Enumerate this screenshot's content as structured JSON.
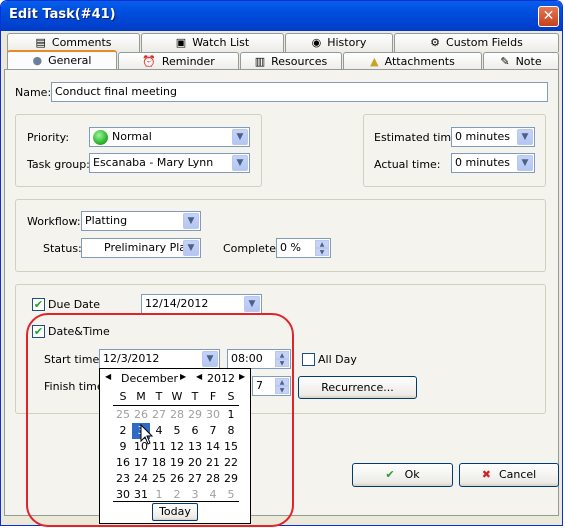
{
  "window": {
    "title": "Edit Task(#41)",
    "close_glyph": "✕"
  },
  "tabs_top": [
    {
      "label": "Comments",
      "icon": "comments-icon"
    },
    {
      "label": "Watch List",
      "icon": "watch-list-icon"
    },
    {
      "label": "History",
      "icon": "history-icon"
    },
    {
      "label": "Custom Fields",
      "icon": "custom-fields-icon"
    }
  ],
  "tabs_bottom": [
    {
      "label": "General",
      "icon": "general-icon",
      "active": true
    },
    {
      "label": "Reminder",
      "icon": "reminder-icon"
    },
    {
      "label": "Resources",
      "icon": "resources-icon"
    },
    {
      "label": "Attachments",
      "icon": "attachments-icon"
    },
    {
      "label": "Note",
      "icon": "note-icon"
    }
  ],
  "name": {
    "label": "Name:",
    "value": "Conduct final meeting"
  },
  "priority": {
    "label": "Priority:",
    "value": "Normal",
    "color": "#2fb52f"
  },
  "task_group": {
    "label": "Task group:",
    "value": "Escanaba - Mary Lynn"
  },
  "estimated_time": {
    "label": "Estimated time:",
    "value": "0 minutes"
  },
  "actual_time": {
    "label": "Actual time:",
    "value": "0 minutes"
  },
  "workflow": {
    "label": "Workflow:",
    "value": "Platting"
  },
  "status": {
    "label": "Status:",
    "value": "Preliminary Plat"
  },
  "complete": {
    "label": "Complete:",
    "value": "0 %"
  },
  "due_date": {
    "label": "Due Date",
    "checked": true,
    "value": "12/14/2012"
  },
  "date_time": {
    "label": "Date&Time",
    "checked": true
  },
  "start_time": {
    "label": "Start time:",
    "date": "12/3/2012",
    "time": "08:00"
  },
  "all_day": {
    "label": "All Day",
    "checked": false
  },
  "finish_time": {
    "label": "Finish time:",
    "time_partial": "7"
  },
  "recurrence_button": "Recurrence...",
  "ok_button": "Ok",
  "cancel_button": "Cancel",
  "calendar": {
    "month": "December",
    "year": "2012",
    "weekdays": [
      "S",
      "M",
      "T",
      "W",
      "T",
      "F",
      "S"
    ],
    "weeks": [
      [
        "25",
        "26",
        "27",
        "28",
        "29",
        "30",
        "1"
      ],
      [
        "2",
        "3",
        "4",
        "5",
        "6",
        "7",
        "8"
      ],
      [
        "9",
        "10",
        "11",
        "12",
        "13",
        "14",
        "15"
      ],
      [
        "16",
        "17",
        "18",
        "19",
        "20",
        "21",
        "22"
      ],
      [
        "23",
        "24",
        "25",
        "26",
        "27",
        "28",
        "29"
      ],
      [
        "30",
        "31",
        "1",
        "2",
        "3",
        "4",
        "5"
      ]
    ],
    "selected": "3",
    "today_button": "Today"
  },
  "colors": {
    "accent": "#316ac5",
    "highlight": "#e0242a",
    "titlebar": "#0055e5"
  }
}
